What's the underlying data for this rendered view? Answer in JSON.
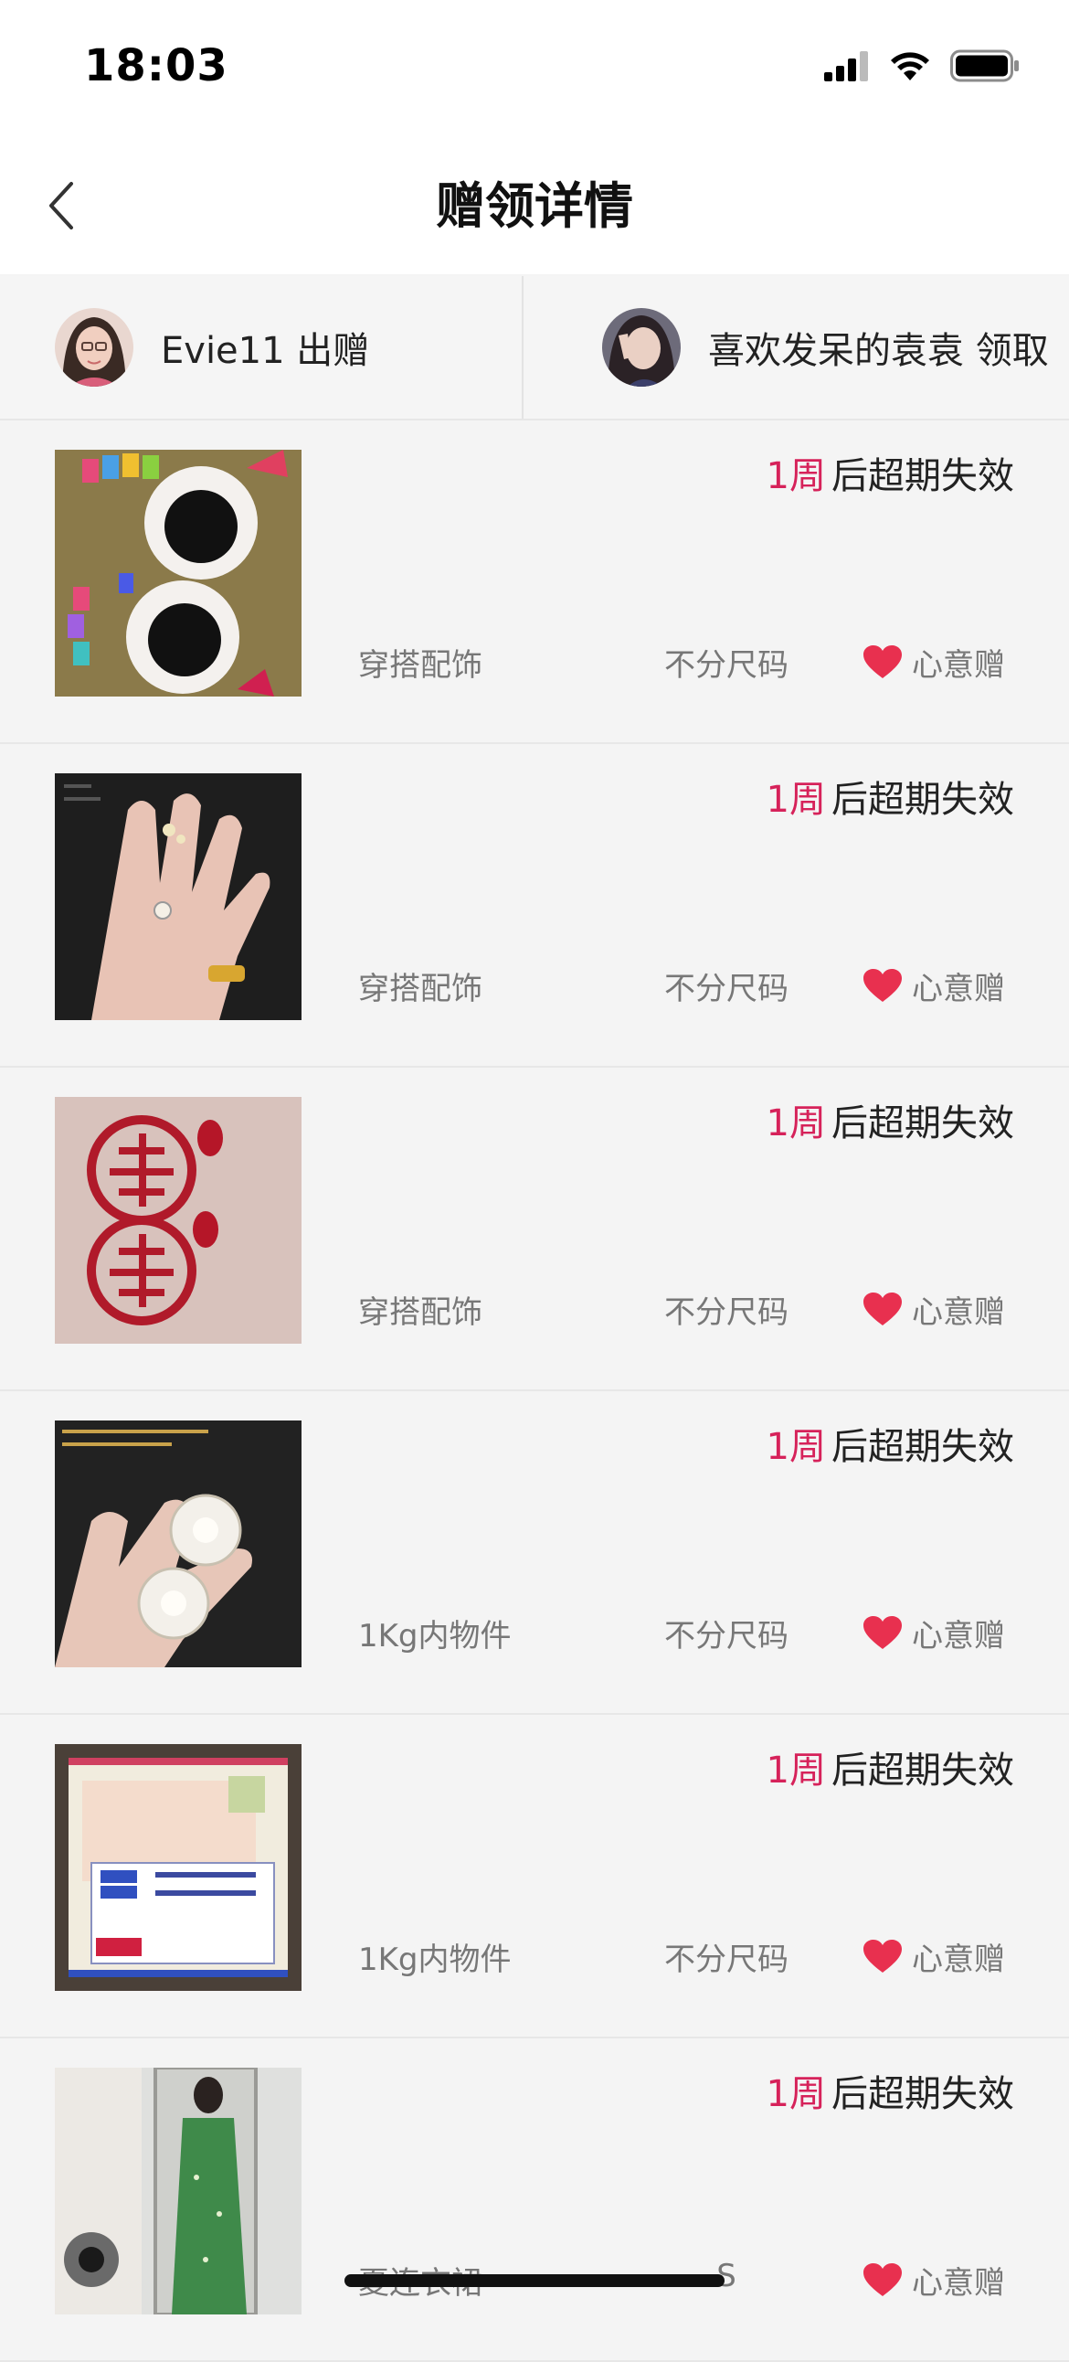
{
  "status": {
    "time": "18:03"
  },
  "nav": {
    "title": "赠领详情"
  },
  "parties": {
    "giver": {
      "name": "Evie11",
      "action": "出赠",
      "text": "Evie11 出赠"
    },
    "receiver": {
      "name": "喜欢发呆的袁袁",
      "action": "领取",
      "text": "喜欢发呆的袁袁 领取"
    }
  },
  "items": [
    {
      "expire_num": "1周",
      "expire_text": "后超期失效",
      "category": "穿搭配饰",
      "size": "不分尺码",
      "gift_label": "心意赠"
    },
    {
      "expire_num": "1周",
      "expire_text": "后超期失效",
      "category": "穿搭配饰",
      "size": "不分尺码",
      "gift_label": "心意赠"
    },
    {
      "expire_num": "1周",
      "expire_text": "后超期失效",
      "category": "穿搭配饰",
      "size": "不分尺码",
      "gift_label": "心意赠"
    },
    {
      "expire_num": "1周",
      "expire_text": "后超期失效",
      "category": "1Kg内物件",
      "size": "不分尺码",
      "gift_label": "心意赠"
    },
    {
      "expire_num": "1周",
      "expire_text": "后超期失效",
      "category": "1Kg内物件",
      "size": "不分尺码",
      "gift_label": "心意赠"
    },
    {
      "expire_num": "1周",
      "expire_text": "后超期失效",
      "category": "夏连衣裙",
      "size": "S",
      "gift_label": "心意赠"
    }
  ],
  "colors": {
    "accent": "#d6225a",
    "heart": "#e8304f"
  },
  "icons": [
    "signal-icon",
    "wifi-icon",
    "battery-icon",
    "back-chevron-icon",
    "heart-icon"
  ]
}
